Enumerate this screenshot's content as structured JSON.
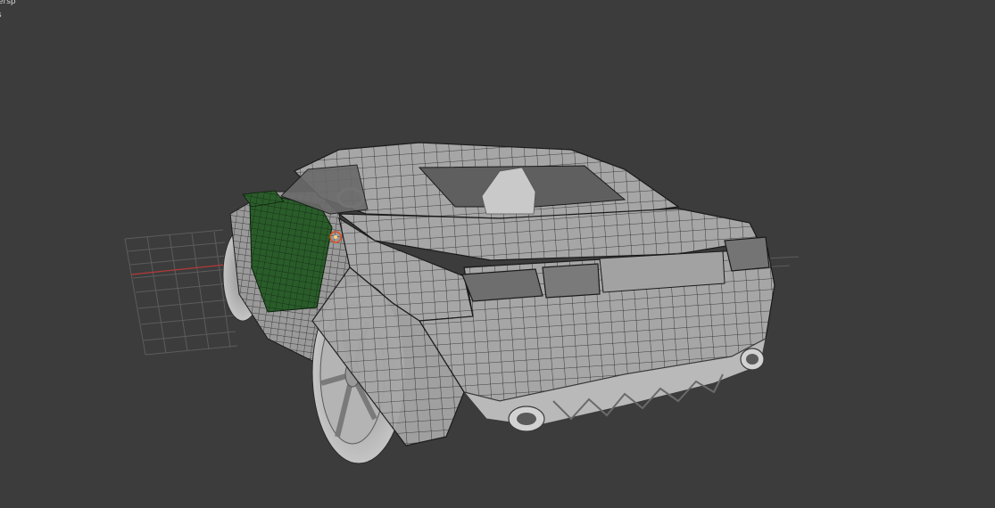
{
  "viewport": {
    "label_line_1": "ersp",
    "label_line_2": "s"
  },
  "colors": {
    "background": "#3c3c3c",
    "grid": "#5a5a5a",
    "axis_x": "#b33a3a",
    "mesh_fill": "#a9a9a9",
    "mesh_wire": "#1b1b1b",
    "selected_face": "#1f5a1f",
    "pivot": "#e05020"
  },
  "scene": {
    "object": "car-model",
    "selection": "side-panels"
  }
}
